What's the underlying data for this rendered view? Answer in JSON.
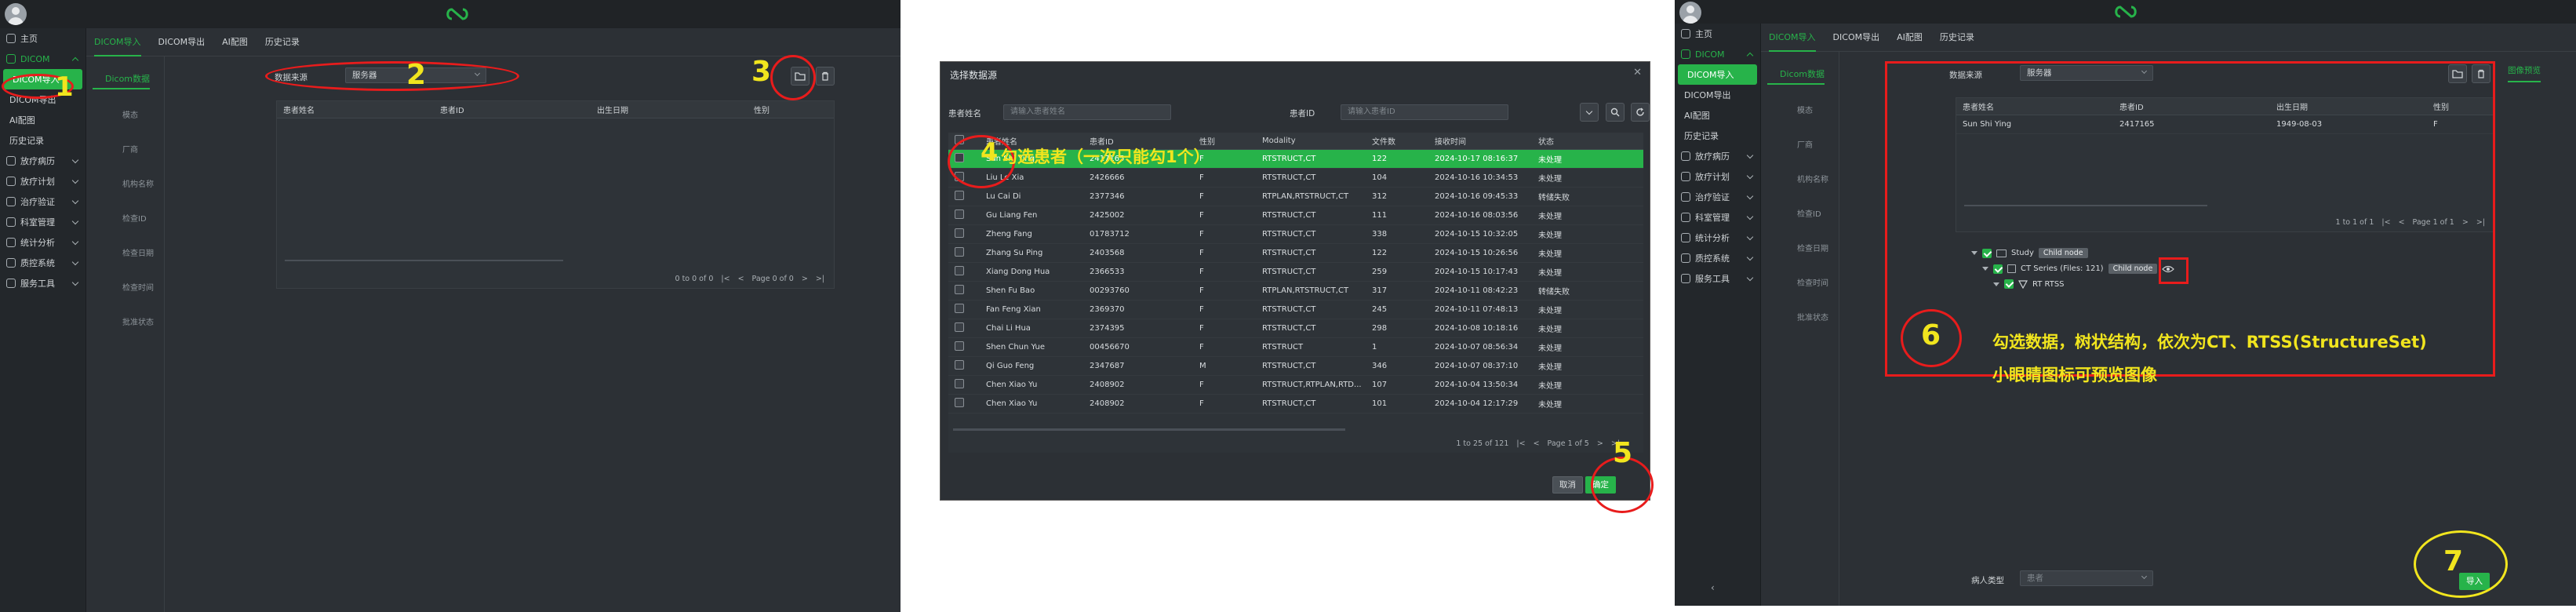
{
  "app": {
    "nav": [
      {
        "label": "主页",
        "type": "item"
      },
      {
        "label": "DICOM",
        "type": "group"
      },
      {
        "label": "DICOM导入",
        "type": "sub"
      },
      {
        "label": "DICOM导出",
        "type": "sub"
      },
      {
        "label": "AI配图",
        "type": "sub"
      },
      {
        "label": "历史记录",
        "type": "sub"
      },
      {
        "label": "放疗病历",
        "type": "item"
      },
      {
        "label": "放疗计划",
        "type": "item"
      },
      {
        "label": "治疗验证",
        "type": "item"
      },
      {
        "label": "科室管理",
        "type": "item"
      },
      {
        "label": "统计分析",
        "type": "item"
      },
      {
        "label": "质控系统",
        "type": "item"
      },
      {
        "label": "服务工具",
        "type": "item"
      }
    ],
    "tabs": [
      "DICOM导入",
      "DICOM导出",
      "AI配图",
      "历史记录"
    ],
    "filter_title": "Dicom数据",
    "filter_items": [
      "模态",
      "厂商",
      "机构名称",
      "检查ID",
      "检查日期",
      "检查时间",
      "批准状态"
    ],
    "source_label": "数据来源",
    "source_value": "服务器",
    "patient_cols": [
      "患者姓名",
      "患者ID",
      "出生日期",
      "性别"
    ],
    "preview_tab": "图像预览"
  },
  "panel1": {
    "pager": "0 to 0 of 0",
    "page": "Page 0 of 0"
  },
  "dialog": {
    "title": "选择数据源",
    "name_label": "患者姓名",
    "name_placeholder": "请输入患者姓名",
    "id_label": "患者ID",
    "id_placeholder": "请输入患者ID",
    "cols": [
      "患者姓名",
      "患者ID",
      "性别",
      "Modality",
      "文件数",
      "接收时间",
      "状态"
    ],
    "rows": [
      [
        "Sun Shi Ying",
        "2417165",
        "F",
        "RTSTRUCT,CT",
        "122",
        "2024-10-17 08:16:37",
        "未处理"
      ],
      [
        "Liu Le Xia",
        "2426666",
        "F",
        "RTSTRUCT,CT",
        "104",
        "2024-10-16 10:34:53",
        "未处理"
      ],
      [
        "Lu Cai Di",
        "2377346",
        "F",
        "RTPLAN,RTSTRUCT,CT",
        "312",
        "2024-10-16 09:45:33",
        "转储失败"
      ],
      [
        "Gu Liang Fen",
        "2425002",
        "F",
        "RTSTRUCT,CT",
        "111",
        "2024-10-16 08:03:56",
        "未处理"
      ],
      [
        "Zheng Fang",
        "01783712",
        "F",
        "RTSTRUCT,CT",
        "338",
        "2024-10-15 10:32:05",
        "未处理"
      ],
      [
        "Zhang Su Ping",
        "2403568",
        "F",
        "RTSTRUCT,CT",
        "122",
        "2024-10-15 10:26:56",
        "未处理"
      ],
      [
        "Xiang Dong Hua",
        "2366533",
        "F",
        "RTSTRUCT,CT",
        "259",
        "2024-10-15 10:17:43",
        "未处理"
      ],
      [
        "Shen Fu Bao",
        "00293760",
        "F",
        "RTPLAN,RTSTRUCT,CT",
        "317",
        "2024-10-11 08:42:23",
        "转储失败"
      ],
      [
        "Fan Feng Xian",
        "2369370",
        "F",
        "RTSTRUCT,CT",
        "245",
        "2024-10-11 07:48:13",
        "未处理"
      ],
      [
        "Chai Li Hua",
        "2374395",
        "F",
        "RTSTRUCT,CT",
        "298",
        "2024-10-08 10:18:16",
        "未处理"
      ],
      [
        "Shen Chun Yue",
        "00456670",
        "F",
        "RTSTRUCT",
        "1",
        "2024-10-07 08:56:34",
        "未处理"
      ],
      [
        "Qi Guo Feng",
        "2347687",
        "M",
        "RTSTRUCT,CT",
        "346",
        "2024-10-07 08:37:10",
        "未处理"
      ],
      [
        "Chen Xiao Yu",
        "2408902",
        "F",
        "RTSTRUCT,RTPLAN,RTD...",
        "107",
        "2024-10-04 13:50:34",
        "未处理"
      ],
      [
        "Chen Xiao Yu",
        "2408902",
        "F",
        "RTSTRUCT,CT",
        "101",
        "2024-10-04 12:17:29",
        "未处理"
      ]
    ],
    "pager": "1 to 25 of 121",
    "page": "Page 1 of 5",
    "cancel": "取消",
    "confirm": "确定"
  },
  "panel3": {
    "patient_row": [
      "Sun Shi Ying",
      "2417165",
      "1949-08-03",
      "F"
    ],
    "pager": "1 to 1 of 1",
    "page": "Page 1 of 1",
    "tree": {
      "study": "Study",
      "study_chip": "Child node",
      "series": "CT Series (Files: 121)",
      "series_chip": "Child node",
      "rtss": "RT RTSS"
    },
    "case_type_label": "病人类型",
    "case_type_value": "患者",
    "import": "导入"
  },
  "annotations": {
    "n1": "1",
    "n2": "2",
    "n3": "3",
    "n4": "4",
    "n5": "5",
    "n6": "6",
    "n7": "7",
    "note4": "勾选患者（一次只能勾1个）",
    "note6a": "勾选数据，树状结构，依次为CT、RTSS(StructureSet)",
    "note6b": "小眼睛图标可预览图像"
  }
}
